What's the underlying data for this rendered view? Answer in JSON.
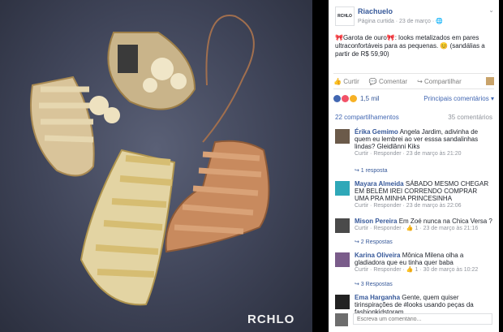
{
  "photo": {
    "brand_mark": "RCHLO"
  },
  "post": {
    "page_name": "Riachuelo",
    "meta": "Página curtida · 23 de março · 🌐",
    "text": "🎀Garota de ouro🎀: looks metalizados em pares ultraconfortáveis para as pequenas. 😊 (sandálias a partir de R$ 59,90)",
    "actions": [
      "Curtir",
      "Comentar",
      "Compartilhar"
    ],
    "reactions_count": "1,5 mil",
    "top_comments": "Principais comentários ▾",
    "shares": "22 compartilhamentos",
    "total_comments": "35 comentários"
  },
  "comments": [
    {
      "author": "Érika Gemimo",
      "text": "Angela Jardim, adivinha de quem eu lembrei ao ver esssa sandalinhas lindas? Gleidlânni Kiks",
      "meta": "Curtir · Responder · 23 de março às 21:20",
      "replies": "↪ 1 resposta",
      "avatar_color": "#6b5a4a"
    },
    {
      "author": "Mayara Almeida",
      "text": "SÁBADO MESMO CHEGAR EM BELÉM IREI CORRENDO COMPRAR UMA PRA MINHA PRINCESINHA",
      "meta": "Curtir · Responder · 23 de março às 22:06",
      "replies": "",
      "avatar_color": "#2fa8b8"
    },
    {
      "author": "Mison Pereira",
      "text": "Em Zoé nunca na Chica Versa ?",
      "meta": "Curtir · Responder · 👍 1 · 23 de março às 21:16",
      "replies": "↪ 2 Respostas",
      "avatar_color": "#4a4a4a"
    },
    {
      "author": "Karina Oliveira",
      "text": "Mônica Milena olha a gladiadora que eu tinha quer baba",
      "meta": "Curtir · Responder · 👍 1 · 30 de março às 10:22",
      "replies": "↪ 3 Respostas",
      "avatar_color": "#7a5c8a"
    },
    {
      "author": "Ema Harganha",
      "text": "Gente, quem quiser tirinspirações de #looks usando peças da fashionkidstoram",
      "meta": "",
      "replies": "",
      "avatar_color": "#222222"
    }
  ],
  "compose": {
    "placeholder": "Escreva um comentário..."
  },
  "colors": {
    "link": "#365899",
    "photo_bg": "#3f4458",
    "gold": "#d8c38c",
    "rose_gold": "#c78b62"
  }
}
